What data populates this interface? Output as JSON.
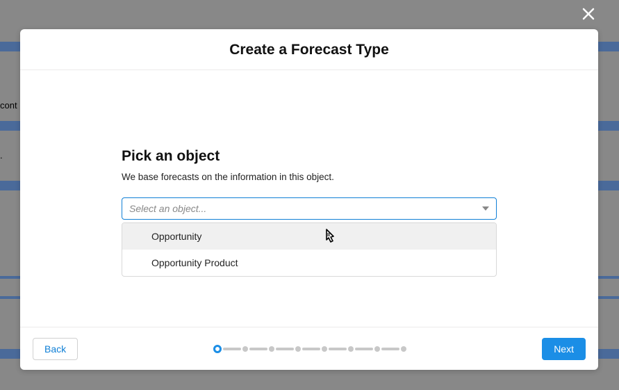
{
  "modal": {
    "title": "Create a Forecast Type",
    "section_title": "Pick an object",
    "section_desc": "We base forecasts on the information in this object.",
    "select_placeholder": "Select an object...",
    "options": [
      {
        "label": "Opportunity"
      },
      {
        "label": "Opportunity Product"
      }
    ]
  },
  "footer": {
    "back_label": "Back",
    "next_label": "Next"
  },
  "background": {
    "text_cont": "cont",
    "text_dot": "."
  }
}
